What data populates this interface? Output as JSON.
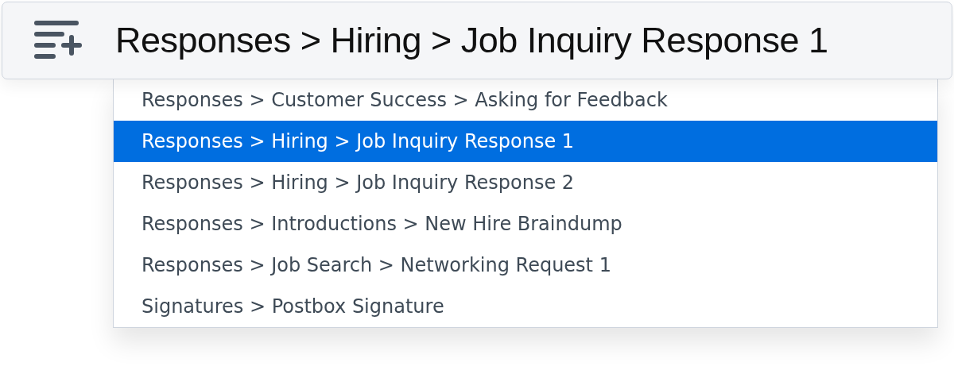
{
  "search_bar": {
    "value": "Responses > Hiring > Job Inquiry Response 1"
  },
  "suggestions": [
    {
      "label": "Responses > Customer Success > Asking for Feedback",
      "selected": false
    },
    {
      "label": "Responses > Hiring > Job Inquiry Response 1",
      "selected": true
    },
    {
      "label": "Responses > Hiring > Job Inquiry Response 2",
      "selected": false
    },
    {
      "label": "Responses > Introductions > New Hire Braindump",
      "selected": false
    },
    {
      "label": "Responses > Job Search > Networking Request 1",
      "selected": false
    },
    {
      "label": "Signatures > Postbox Signature",
      "selected": false
    }
  ]
}
